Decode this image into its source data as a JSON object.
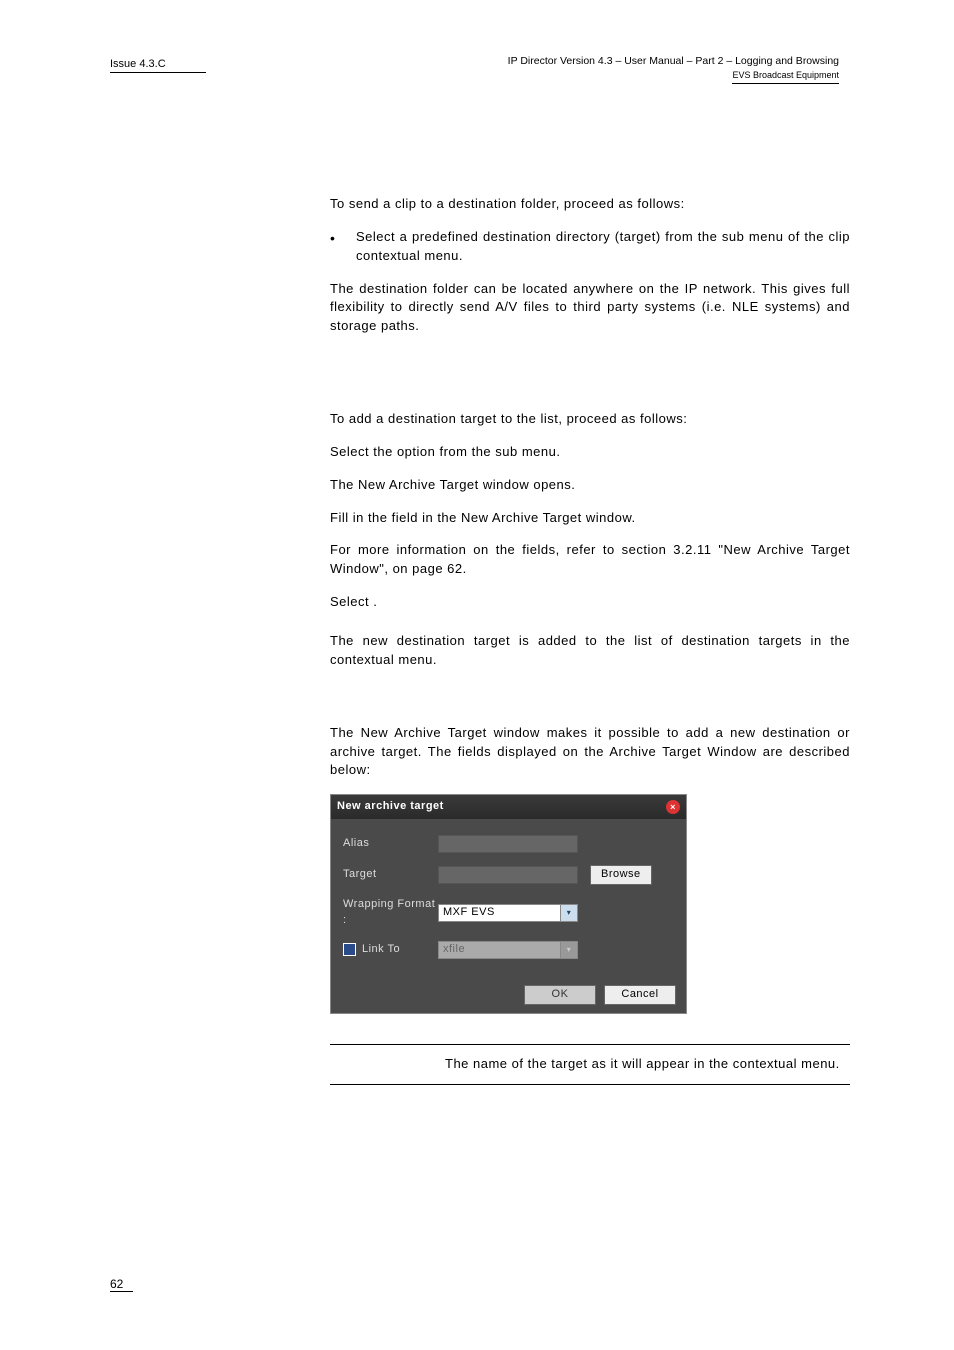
{
  "header": {
    "issue": "Issue 4.3.C",
    "right1": "IP Director Version 4.3 – User Manual – Part 2 – Logging and Browsing",
    "right2": "EVS Broadcast Equipment"
  },
  "body": {
    "p1": "To send a clip to a destination folder, proceed as follows:",
    "b1": "Select a predefined destination directory (target) from the sub menu of the clip contextual menu.",
    "p2": "The destination folder can be located anywhere on the IP network. This gives full flexibility to directly send A/V files to third party systems (i.e. NLE systems) and storage paths.",
    "p3": "To add a destination target to the list, proceed as follows:",
    "s1a": "Select the ",
    "s1b": " option from the sub menu.",
    "s2": "The New Archive Target window opens.",
    "s3": "Fill in the field in the New Archive Target window.",
    "s4": "For more information on the fields, refer to section 3.2.11 \"New Archive Target Window\", on page 62.",
    "s5a": "Select ",
    "s5b": ".",
    "p4": "The new destination target is added to the list of destination targets in the contextual menu.",
    "p5": "The New Archive Target window makes it possible to add a new destination or archive target. The fields displayed on the Archive Target Window are described below:"
  },
  "dialog": {
    "title": "New archive target",
    "alias_label": "Alias",
    "target_label": "Target",
    "wrap_label": "Wrapping Format :",
    "linkto_label": "Link To",
    "browse": "Browse",
    "wrap_value": "MXF EVS",
    "linkto_value": "xfile",
    "ok": "OK",
    "cancel": "Cancel"
  },
  "def": {
    "term": "",
    "desc": "The name of the target as it will appear in the contextual menu."
  },
  "page": "62"
}
